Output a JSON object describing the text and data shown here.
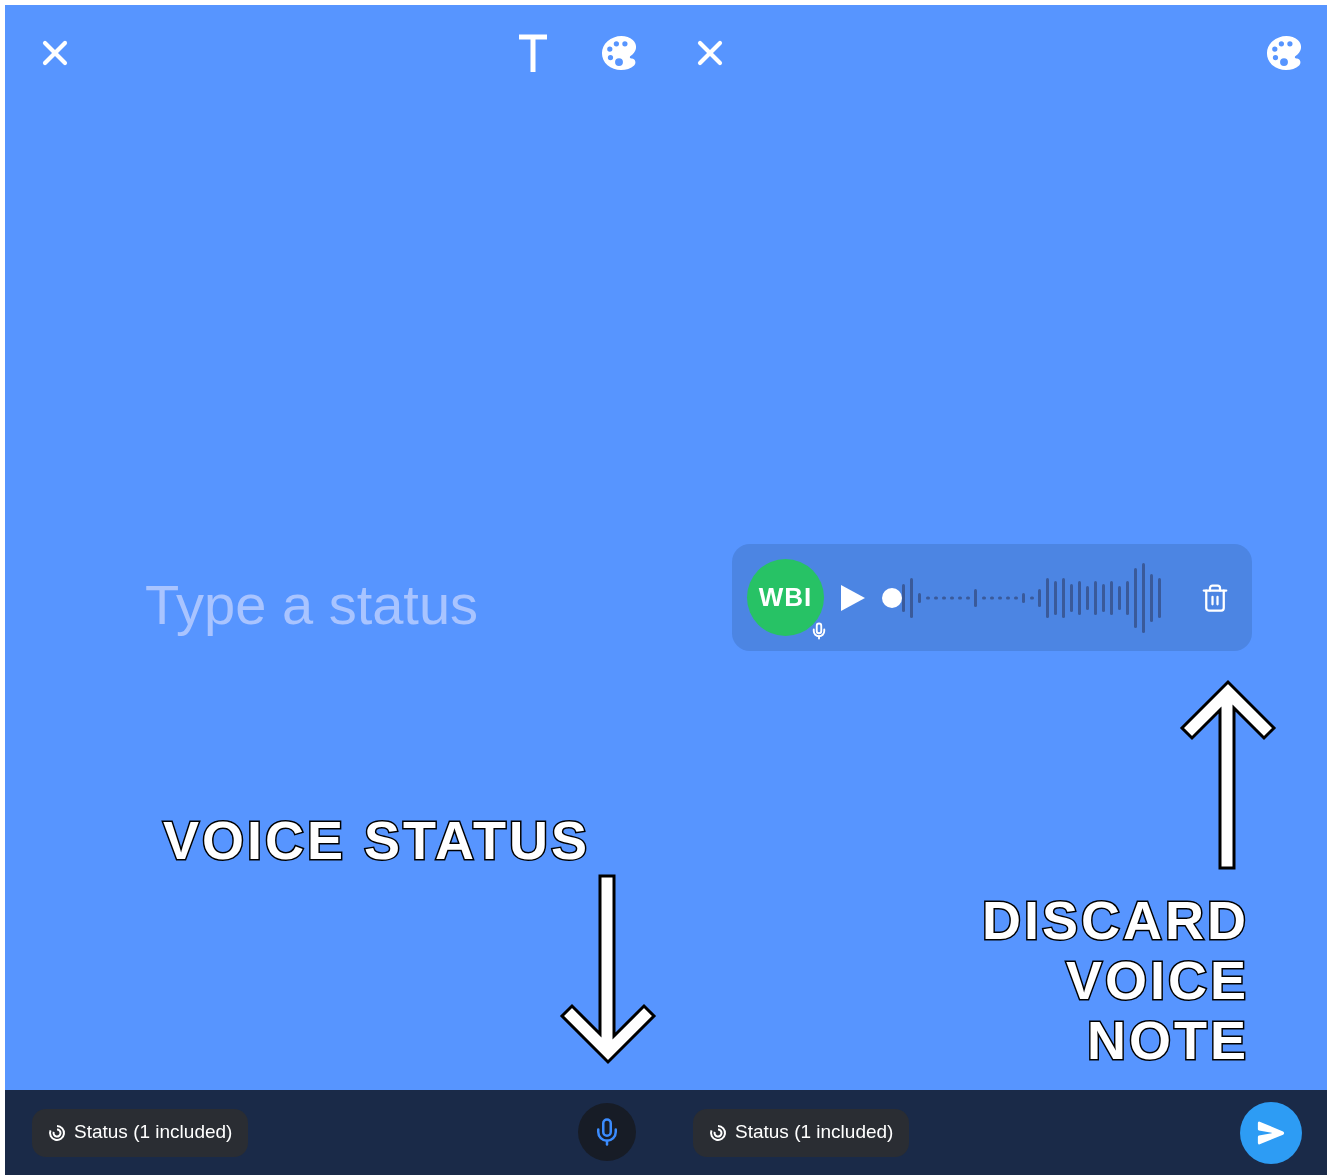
{
  "left_screen": {
    "status_input": {
      "placeholder": "Type a status"
    }
  },
  "right_screen": {
    "voice_note": {
      "avatar_text": "WBI"
    }
  },
  "annotations": [
    {
      "kind": "down",
      "text": "VOICE STATUS"
    },
    {
      "kind": "up",
      "text": "DISCARD VOICE NOTE"
    }
  ],
  "bottom_bar": {
    "audience_buttons": [
      "Status (1 included)",
      "Status (1 included)"
    ]
  }
}
